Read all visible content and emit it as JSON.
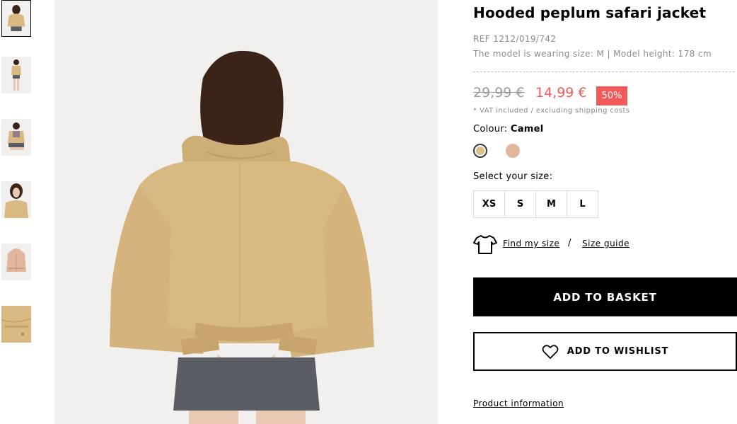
{
  "thumbnails": [
    {
      "name": "thumbnail-back-view",
      "active": true
    },
    {
      "name": "thumbnail-full-body",
      "active": false
    },
    {
      "name": "thumbnail-seated",
      "active": false
    },
    {
      "name": "thumbnail-close-up",
      "active": false
    },
    {
      "name": "thumbnail-product-flat",
      "active": false
    },
    {
      "name": "thumbnail-fabric-detail",
      "active": false
    }
  ],
  "product": {
    "title": "Hooded peplum safari jacket",
    "ref": "REF 1212/019/742",
    "model_info": "The model is wearing size: M | Model height: 178 cm",
    "price_old": "29,99 €",
    "price_new": "14,99 €",
    "discount": "50%",
    "vat_note": "* VAT included / excluding shipping costs"
  },
  "colour": {
    "label": "Colour:",
    "selected": "Camel",
    "swatches": [
      {
        "name": "Camel",
        "hex": "#d9c08a",
        "selected": true
      },
      {
        "name": "Pink",
        "hex": "#e0b79e",
        "selected": false
      }
    ]
  },
  "size": {
    "label": "Select your size:",
    "options": [
      "XS",
      "S",
      "M",
      "L"
    ]
  },
  "fit": {
    "find_my_size": "Find my size",
    "separator": "/",
    "size_guide": "Size guide"
  },
  "actions": {
    "add_to_basket": "ADD TO BASKET",
    "add_to_wishlist": "ADD TO WISHLIST"
  },
  "links": {
    "product_information": "Product information"
  },
  "colors": {
    "sale_red": "#f25a5a",
    "muted_text": "#8a8a8a",
    "jacket": "#d9b982",
    "hair": "#3b2318",
    "denim": "#5a5d63",
    "background": "#f1f0ee"
  }
}
